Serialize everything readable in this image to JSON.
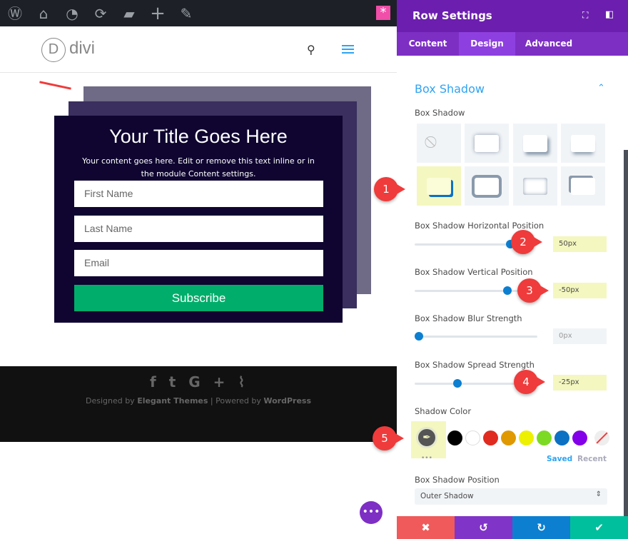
{
  "adminbar": {
    "icons": [
      "wordpress-icon",
      "my-sites-icon",
      "dashboard-icon",
      "updates-icon",
      "comments-icon",
      "new-icon",
      "edit-icon",
      "divi-builder-icon"
    ]
  },
  "site": {
    "logo_letter": "D",
    "logo_text": "divi"
  },
  "module": {
    "title": "Your Title Goes Here",
    "body": "Your content goes here. Edit or remove this text inline or in the module Content settings.",
    "fields": [
      "First Name",
      "Last Name",
      "Email"
    ],
    "button": "Subscribe",
    "colors": {
      "front": "#0f0530",
      "mid": "#3a2f5e",
      "back": "#6f6a85",
      "button": "#00ad6a"
    }
  },
  "footer": {
    "credit_pre": "Designed by ",
    "credit_a": "Elegant Themes",
    "credit_mid": " | Powered by ",
    "credit_b": "WordPress",
    "social": [
      "facebook-icon",
      "twitter-icon",
      "google-plus-icon",
      "rss-icon"
    ]
  },
  "panel": {
    "title": "Row Settings",
    "tabs": [
      "Content",
      "Design",
      "Advanced"
    ],
    "active_tab": "Design",
    "section": "Box Shadow",
    "box_shadow_label": "Box Shadow",
    "selected_preset": 5,
    "horizontal": {
      "label": "Box Shadow Horizontal Position",
      "value": "50px"
    },
    "vertical": {
      "label": "Box Shadow Vertical Position",
      "value": "-50px"
    },
    "blur": {
      "label": "Box Shadow Blur Strength",
      "value": "0px"
    },
    "spread": {
      "label": "Box Shadow Spread Strength",
      "value": "-25px"
    },
    "color_label": "Shadow Color",
    "swatches": [
      "#000000",
      "#ffffff",
      "#e02b20",
      "#e09900",
      "#edf000",
      "#7cda24",
      "#0c71c3",
      "#8300e9"
    ],
    "saved": "Saved",
    "recent": "Recent",
    "more": "•••",
    "position_label": "Box Shadow Position",
    "position_value": "Outer Shadow",
    "accent": "#6c1fae"
  },
  "annotations": [
    "1",
    "2",
    "3",
    "4",
    "5"
  ],
  "actions": {
    "cancel": "✖",
    "undo": "↺",
    "redo": "↻",
    "save": "✔"
  }
}
